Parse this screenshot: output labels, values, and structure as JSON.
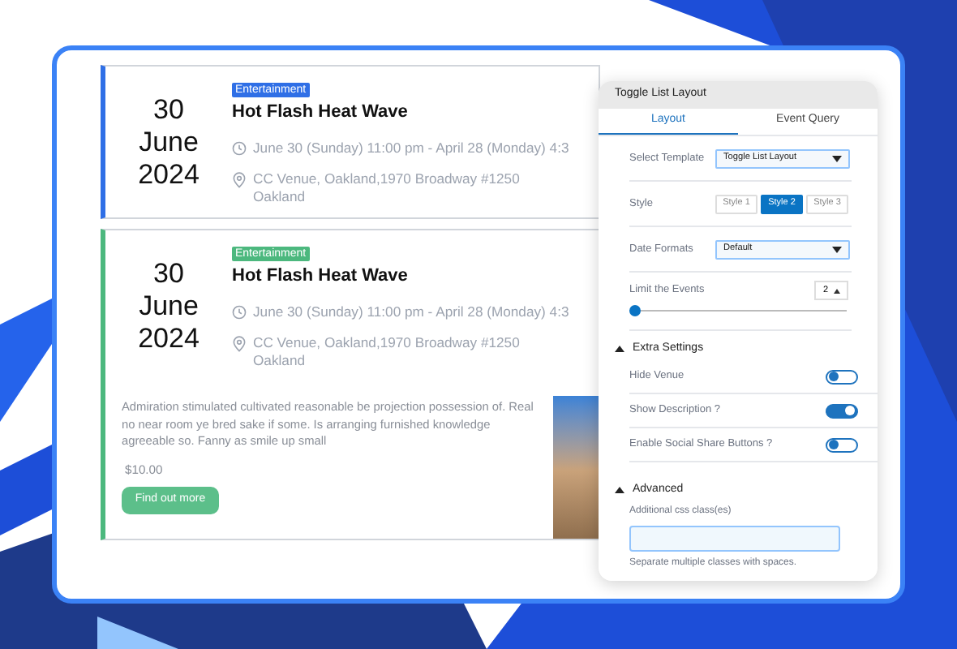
{
  "events": [
    {
      "kind": "compact",
      "category": "Entertainment",
      "color": "#2f6fe6",
      "day": "30",
      "month": "June",
      "year": "2024",
      "title": "Hot Flash Heat Wave",
      "time": "June 30 (Sunday) 11:00 pm - April 28 (Monday) 4:3",
      "venue": "CC Venue, Oakland,1970 Broadway #1250 Oakland"
    },
    {
      "kind": "detailed",
      "category": "Entertainment",
      "color": "#4cb87e",
      "day": "30",
      "month": "June",
      "year": "2024",
      "title": "Hot Flash Heat Wave",
      "time": "June 30 (Sunday) 11:00 pm - April 28 (Monday) 4:3",
      "venue": "CC Venue, Oakland,1970 Broadway #1250 Oakland",
      "description": "Admiration stimulated cultivated reasonable be projection possession of. Real no near room ye bred sake if some. Is arranging furnished knowledge agreeable so. Fanny as smile up small",
      "price": "$10.00",
      "button": "Find out more"
    }
  ],
  "panel": {
    "title": "Toggle List Layout",
    "tabs": [
      {
        "label": "Layout",
        "selected": true
      },
      {
        "label": "Event Query",
        "selected": false
      }
    ],
    "settings": [
      {
        "kind": "select",
        "label": "Select Template",
        "value": "Toggle List Layout"
      },
      {
        "kind": "segmented",
        "label": "Style",
        "options": [
          {
            "label": "Style 1",
            "selected": false
          },
          {
            "label": "Style 2",
            "selected": true
          },
          {
            "label": "Style 3",
            "selected": false
          }
        ]
      },
      {
        "kind": "select",
        "label": "Date Formats",
        "value": "Default"
      },
      {
        "kind": "slider",
        "label": "Limit the Events",
        "value": "2",
        "level": 0.02
      }
    ],
    "sections": [
      {
        "title": "Extra Settings",
        "expanded": true,
        "items": [
          {
            "kind": "toggle",
            "label": "Hide Venue",
            "on": false
          },
          {
            "kind": "toggle",
            "label": "Show Description ?",
            "on": true
          },
          {
            "kind": "toggle",
            "label": "Enable Social Share Buttons ?",
            "on": false
          }
        ]
      },
      {
        "title": "Advanced",
        "expanded": true,
        "items": [
          {
            "kind": "text",
            "label": "Additional css class(es)",
            "help": "Separate multiple classes with spaces."
          }
        ]
      }
    ]
  }
}
